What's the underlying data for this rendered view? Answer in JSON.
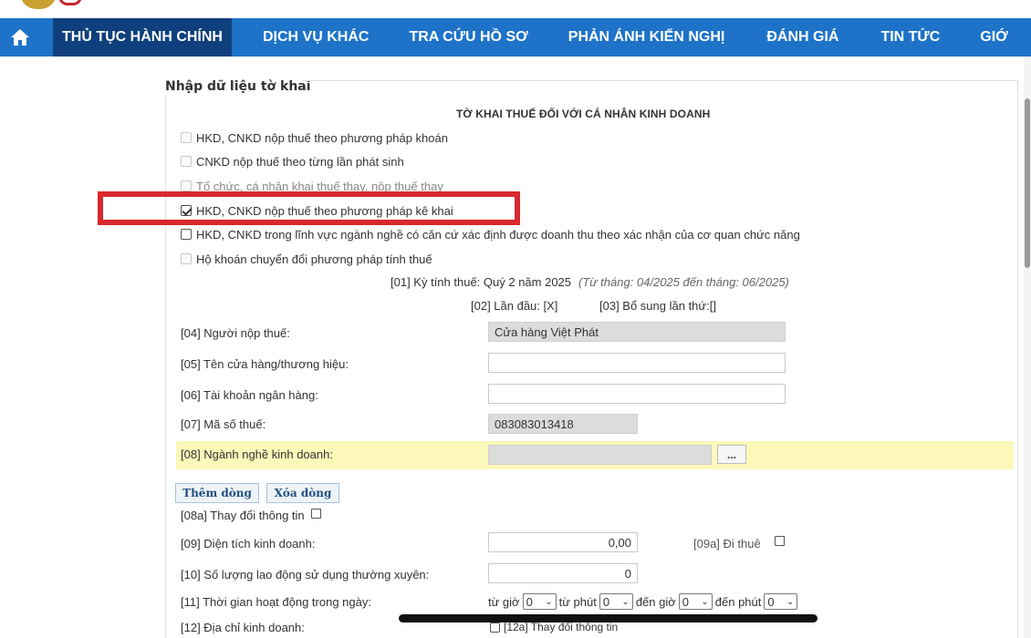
{
  "nav": {
    "items": [
      "THỦ TỤC HÀNH CHÍNH",
      "DỊCH VỤ KHÁC",
      "TRA CỨU HỒ SƠ",
      "PHẢN ÁNH KIẾN NGHỊ",
      "ĐÁNH GIÁ",
      "TIN TỨC",
      "GIỚ"
    ],
    "active_index": 0,
    "home_icon": "home-icon",
    "bar_color": "#1e73c9",
    "active_color": "#0f3f7c"
  },
  "panel": {
    "title": "Nhập dữ liệu tờ khai",
    "form_title": "TỜ KHAI THUẾ ĐỐI VỚI CÁ NHÂN KINH DOANH"
  },
  "options": [
    {
      "label": "HKD, CNKD nộp thuế theo phương pháp khoán",
      "checked": false
    },
    {
      "label": "CNKD nộp thuế theo từng lần phát sinh",
      "checked": false
    },
    {
      "label": "Tổ chức, cá nhân khai thuế thay, nộp thuế thay",
      "checked": false
    },
    {
      "label": "HKD, CNKD nộp thuế theo phương pháp kê khai",
      "checked": true
    },
    {
      "label": "HKD, CNKD trong lĩnh vực ngành nghề có căn cứ xác định được doanh thu theo xác nhận của cơ quan chức năng",
      "checked": false
    },
    {
      "label": "Hộ khoán chuyển đổi phương pháp tính thuế",
      "checked": false
    }
  ],
  "highlight_color": "#d9272e",
  "period": {
    "text": "[01] Kỳ tính thuế: Quý 2 năm 2025",
    "note": "(Từ tháng: 04/2025 đến tháng: 06/2025)",
    "first": "[02] Lần đầu: [X]",
    "supplement": "[03] Bổ sung lần thứ:[]"
  },
  "fields": {
    "taxpayer": {
      "label": "[04] Người nộp thuế:",
      "value": "Cửa hàng Việt Phát"
    },
    "store_name": {
      "label": "[05] Tên cửa hàng/thương hiệu:",
      "value": ""
    },
    "bank_account": {
      "label": "[06] Tài khoản ngân hàng:",
      "value": ""
    },
    "tax_code": {
      "label": "[07] Mã số thuế:",
      "value": "083083013418"
    },
    "business_line": {
      "label": "[08] Ngành nghề kinh doanh:",
      "value": "",
      "button": "..."
    }
  },
  "buttons": {
    "add_row": "Thêm dòng",
    "delete_row": "Xóa dòng"
  },
  "change_info": {
    "label": "[08a] Thay đổi thông tin",
    "checked": false
  },
  "area": {
    "label": "[09] Diện tích kinh doanh:",
    "value": "0,00",
    "rent_label": "[09a] Đi thuê",
    "rent_checked": false
  },
  "workers": {
    "label": "[10] Số lượng lao động sử dụng thường xuyên:",
    "value": "0"
  },
  "hours": {
    "label": "[11] Thời gian hoạt động trong ngày:",
    "from_hour_label": "từ giờ",
    "from_hour": "0",
    "from_min_label": "từ phút",
    "from_min": "0",
    "to_hour_label": "đến giờ",
    "to_hour": "0",
    "to_min_label": "đến phút",
    "to_min": "0"
  },
  "address": {
    "label": "[12] Địa chỉ kinh doanh:",
    "change_label": "[12a] Thay đổi thông tin"
  }
}
